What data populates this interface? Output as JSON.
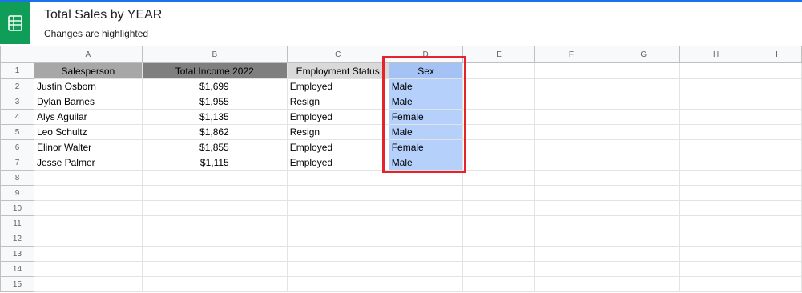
{
  "header": {
    "title": "Total Sales by YEAR",
    "subtitle": "Changes are highlighted",
    "app_icon": "sheets-icon"
  },
  "columns": [
    "A",
    "B",
    "C",
    "D",
    "E",
    "F",
    "G",
    "H",
    "I"
  ],
  "row_numbers": [
    "1",
    "2",
    "3",
    "4",
    "5",
    "6",
    "7",
    "8",
    "9",
    "10",
    "11",
    "12",
    "13",
    "14",
    "15"
  ],
  "table": {
    "headers": [
      "Salesperson",
      "Total Income 2022",
      "Employment Status",
      "Sex"
    ],
    "rows": [
      [
        "Justin Osborn",
        "$1,699",
        "Employed",
        "Male"
      ],
      [
        "Dylan Barnes",
        "$1,955",
        "Resign",
        "Male"
      ],
      [
        "Alys Aguilar",
        "$1,135",
        "Employed",
        "Female"
      ],
      [
        "Leo Schultz",
        "$1,862",
        "Resign",
        "Male"
      ],
      [
        "Elinor Walter",
        "$1,855",
        "Employed",
        "Female"
      ],
      [
        "Jesse Palmer",
        "$1,115",
        "Employed",
        "Male"
      ]
    ]
  },
  "colors": {
    "brand": "#0f9d58",
    "highlight_border": "#e6222d",
    "sex_fill": "#b4d0fb",
    "header_a": "#a7a7a7",
    "header_b": "#7f7f7f",
    "header_c": "#d9d9d9"
  }
}
